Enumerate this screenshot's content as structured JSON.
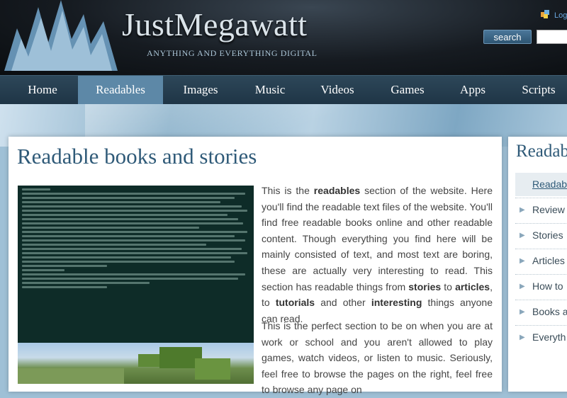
{
  "header": {
    "site_title": "JustMegawatt",
    "tagline": "ANYTHING AND EVERYTHING DIGITAL",
    "login_label": "Log",
    "search_button": "search",
    "search_value": ""
  },
  "nav": {
    "items": [
      "Home",
      "Readables",
      "Images",
      "Music",
      "Videos",
      "Games",
      "Apps",
      "Scripts"
    ],
    "active": "Readables"
  },
  "main": {
    "title": "Readable books and stories",
    "intro": {
      "t1": "This is the ",
      "b1": "readables",
      "t2": " section of the website. Here you'll find the readable text files of the website. You'll find free readable books online and other readable content. Though everything you find here will be mainly consisted of text, and most text are boring, these are actually very interesting to read. This section has readable things from ",
      "b2": "stories",
      "t3": " to ",
      "b3": "articles",
      "t4": ", to ",
      "b4": "tutorials",
      "t5": " and other ",
      "b5": "interesting",
      "t6": " things anyone can read."
    },
    "para2": "This is the perfect section to be on when you are at work or school and you aren't allowed to play games, watch videos, or listen to music. Seriously, feel free to browse the pages on the right, feel free to browse any page on"
  },
  "sidebar": {
    "title": "Readab",
    "active_item": "Readab",
    "items": [
      "Review",
      "Stories",
      "Articles",
      "How to",
      "Books a",
      "Everyth"
    ]
  },
  "colors": {
    "accent": "#2f5a78",
    "nav_bg": "#1f3546",
    "nav_active": "#5d88a7"
  }
}
